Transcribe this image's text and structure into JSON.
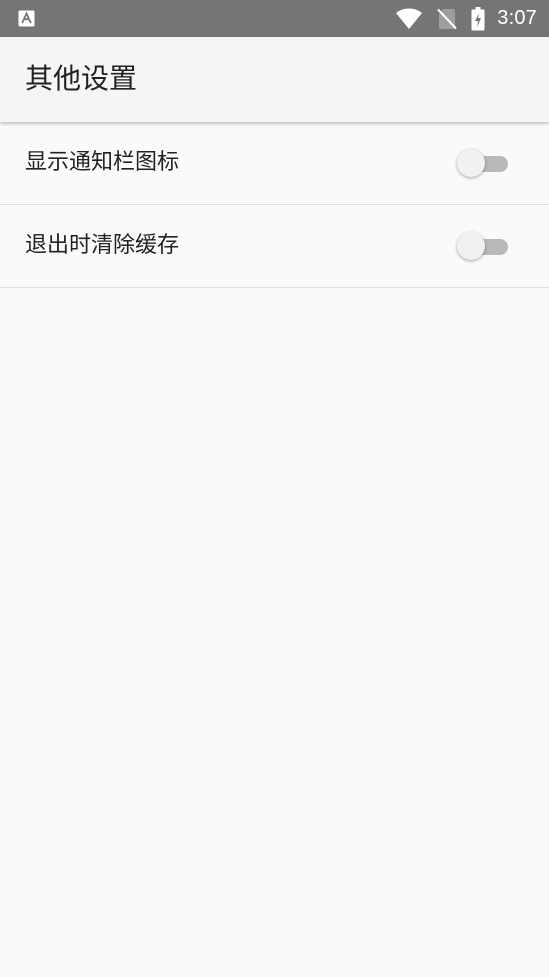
{
  "status_bar": {
    "time": "3:07",
    "left_icon": "keyboard-a-icon",
    "icons": [
      "wifi-icon",
      "no-sim-icon",
      "battery-charging-icon"
    ]
  },
  "app_bar": {
    "title": "其他设置"
  },
  "settings": [
    {
      "label": "显示通知栏图标",
      "enabled": false
    },
    {
      "label": "退出时清除缓存",
      "enabled": false
    }
  ],
  "colors": {
    "status_bar": "#757575",
    "app_bar": "#f5f5f5",
    "background": "#fafafa",
    "switch_track_off": "#b9b9b9",
    "switch_thumb_off": "#f1f1f1"
  }
}
